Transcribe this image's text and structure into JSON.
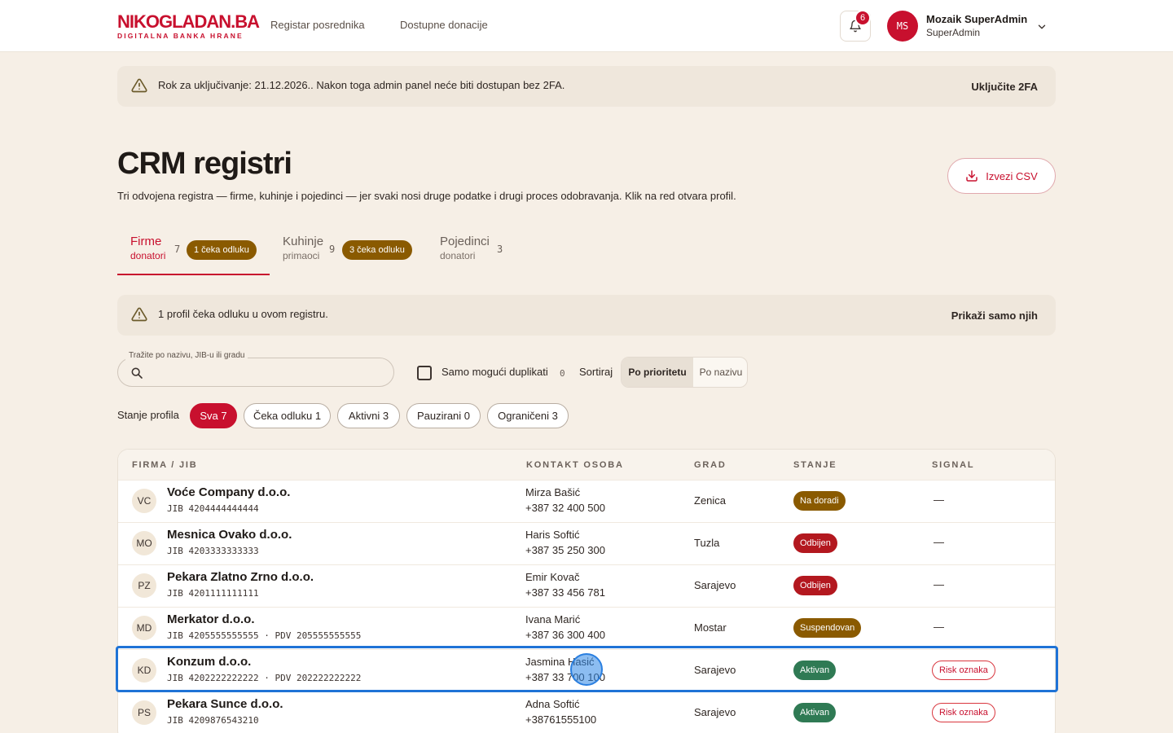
{
  "header": {
    "logo_main": "NIKOGLADAN.BA",
    "logo_sub": "DIGITALNA BANKA HRANE",
    "nav": [
      "Registar posrednika",
      "Dostupne donacije"
    ],
    "notifications_count": "6",
    "avatar_initials": "MS",
    "user_name": "Mozaik SuperAdmin",
    "user_role": "SuperAdmin"
  },
  "banner_2fa": {
    "text": "Rok za uključivanje: 21.12.2026.. Nakon toga admin panel neće biti dostupan bez 2FA.",
    "action": "Uključite 2FA"
  },
  "page": {
    "title": "CRM registri",
    "subtitle": "Tri odvojena registra — firme, kuhinje i pojedinci — jer svaki nosi druge podatke i drugi proces odobravanja. Klik na red otvara profil.",
    "export_label": "Izvezi CSV"
  },
  "tabs": [
    {
      "label": "Firme",
      "sub": "donatori",
      "count": "7",
      "pending": "1 čeka odluku",
      "active": true
    },
    {
      "label": "Kuhinje",
      "sub": "primaoci",
      "count": "9",
      "pending": "3 čeka odluku",
      "active": false
    },
    {
      "label": "Pojedinci",
      "sub": "donatori",
      "count": "3",
      "pending": "",
      "active": false
    }
  ],
  "banner_pending": {
    "text": "1 profil čeka odluku u ovom registru.",
    "action": "Prikaži samo njih"
  },
  "filters": {
    "search_label": "Tražite po nazivu, JIB-u ili gradu",
    "search_value": "",
    "duplicates_label": "Samo mogući duplikati",
    "duplicates_count": "0",
    "sort_label": "Sortiraj",
    "sort_options": [
      "Po prioritetu",
      "Po nazivu"
    ],
    "state_label": "Stanje profila",
    "chips": [
      "Sva 7",
      "Čeka odluku 1",
      "Aktivni 3",
      "Pauzirani 0",
      "Ograničeni 3"
    ]
  },
  "table": {
    "columns": [
      "FIRMA / JIB",
      "KONTAKT OSOBA",
      "GRAD",
      "STANJE",
      "SIGNAL"
    ],
    "rows": [
      {
        "initials": "VC",
        "name": "Voće Company d.o.o.",
        "jib": "JIB 4204444444444",
        "contact": "Mirza Bašić",
        "phone": "+387 32 400 500",
        "city": "Zenica",
        "status": "Na doradi",
        "status_color": "#8a5a00",
        "signal": "—"
      },
      {
        "initials": "MO",
        "name": "Mesnica Ovako d.o.o.",
        "jib": "JIB 4203333333333",
        "contact": "Haris Softić",
        "phone": "+387 35 250 300",
        "city": "Tuzla",
        "status": "Odbijen",
        "status_color": "#b3181f",
        "signal": "—"
      },
      {
        "initials": "PZ",
        "name": "Pekara Zlatno Zrno d.o.o.",
        "jib": "JIB 4201111111111",
        "contact": "Emir Kovač",
        "phone": "+387 33 456 781",
        "city": "Sarajevo",
        "status": "Odbijen",
        "status_color": "#b3181f",
        "signal": "—"
      },
      {
        "initials": "MD",
        "name": "Merkator d.o.o.",
        "jib": "JIB 4205555555555 · PDV 205555555555",
        "contact": "Ivana Marić",
        "phone": "+387 36 300 400",
        "city": "Mostar",
        "status": "Suspendovan",
        "status_color": "#8a5a00",
        "signal": "—"
      },
      {
        "initials": "KD",
        "name": "Konzum d.o.o.",
        "jib": "JIB 4202222222222 · PDV 202222222222",
        "contact": "Jasmina Hasić",
        "phone": "+387 33 700 100",
        "city": "Sarajevo",
        "status": "Aktivan",
        "status_color": "#2f7a54",
        "signal": "Risk oznaka"
      },
      {
        "initials": "PS",
        "name": "Pekara Sunce d.o.o.",
        "jib": "JIB 4209876543210",
        "contact": "Adna Softić",
        "phone": "+38761555100",
        "city": "Sarajevo",
        "status": "Aktivan",
        "status_color": "#2f7a54",
        "signal": "Risk oznaka"
      }
    ]
  },
  "colors": {
    "brand": "#c8102e",
    "background": "#f6efe6",
    "selection": "#1f73d6"
  }
}
